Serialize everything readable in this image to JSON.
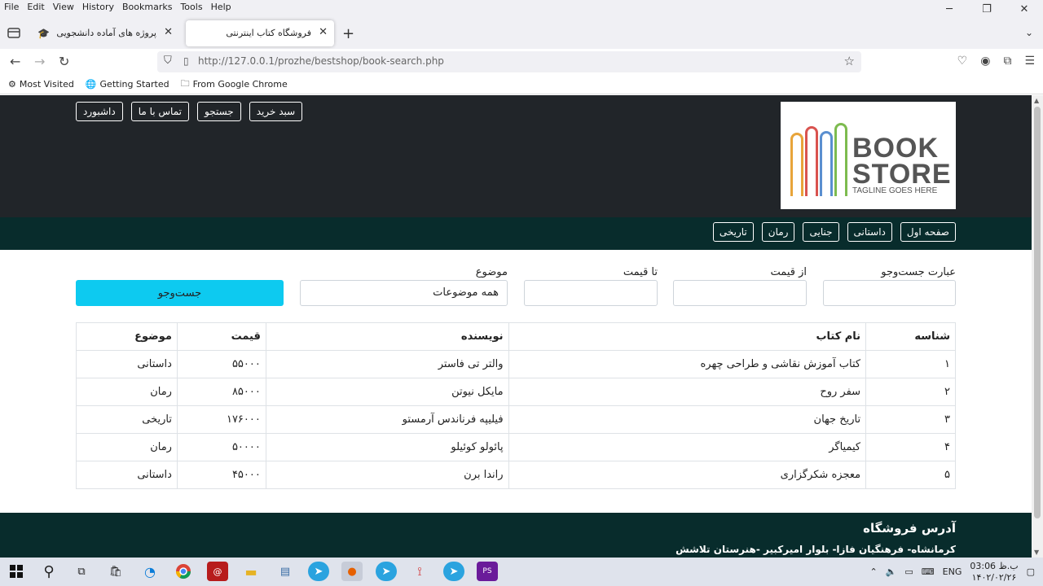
{
  "browser": {
    "menu": [
      "File",
      "Edit",
      "View",
      "History",
      "Bookmarks",
      "Tools",
      "Help"
    ],
    "tabs": [
      {
        "title": "پروژه های آماده دانشجویی",
        "active": false
      },
      {
        "title": "فروشگاه کتاب اینترنتی",
        "active": true
      }
    ],
    "url": "http://127.0.0.1/prozhe/bestshop/book-search.php",
    "bookmarks": [
      "Most Visited",
      "Getting Started",
      "From Google Chrome"
    ]
  },
  "site": {
    "logo": {
      "line1": "BOOK",
      "line2": "STORE",
      "tagline": "TAGLINE GOES HERE"
    },
    "topnav": [
      "سبد خرید",
      "جستجو",
      "تماس با ما",
      "داشبورد"
    ],
    "categories": [
      "صفحه اول",
      "داستانی",
      "جنایی",
      "رمان",
      "تاریخی"
    ],
    "search": {
      "label_query": "عبارت جست‌وجو",
      "label_min": "از قیمت",
      "label_max": "تا قیمت",
      "label_subject": "موضوع",
      "subject_selected": "همه موضوعات",
      "submit": "جست‌وجو"
    },
    "table": {
      "headers": [
        "شناسه",
        "نام کتاب",
        "نویسنده",
        "قیمت",
        "موضوع"
      ],
      "rows": [
        [
          "۱",
          "کتاب آموزش نقاشی و طراحی چهره",
          "والتر تی فاستر",
          "۵۵۰۰۰",
          "داستانی"
        ],
        [
          "۲",
          "سفر روح",
          "مایکل نیوتن",
          "۸۵۰۰۰",
          "رمان"
        ],
        [
          "۳",
          "تاریخ جهان",
          "فیلیپه فرناندس آرمستو",
          "۱۷۶۰۰۰",
          "تاریخی"
        ],
        [
          "۴",
          "کیمیاگر",
          "پائولو کوئیلو",
          "۵۰۰۰۰",
          "رمان"
        ],
        [
          "۵",
          "معجزه شکرگزاری",
          "راندا برن",
          "۴۵۰۰۰",
          "داستانی"
        ]
      ]
    },
    "footer": {
      "title": "آدرس فروشگاه",
      "address": "کرمانشاه- فرهنگیان فازا- بلوار امیرکبیر -هنرستان تلاشش"
    }
  },
  "taskbar": {
    "lang": "ENG",
    "time": "03:06 ب.ظ",
    "date": "۱۴۰۲/۰۲/۲۶"
  }
}
